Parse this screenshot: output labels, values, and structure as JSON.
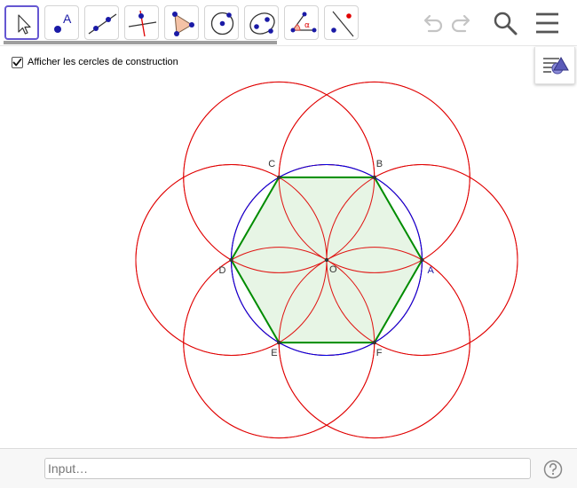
{
  "toolbar": {
    "tools": [
      {
        "name": "move-tool",
        "icon": "cursor-arrow-icon",
        "selected": true
      },
      {
        "name": "point-tool",
        "icon": "point-icon",
        "label": "A"
      },
      {
        "name": "line-tool",
        "icon": "line-through-points-icon"
      },
      {
        "name": "perpendicular-tool",
        "icon": "perpendicular-line-icon"
      },
      {
        "name": "polygon-tool",
        "icon": "polygon-icon"
      },
      {
        "name": "circle-tool",
        "icon": "circle-center-point-icon"
      },
      {
        "name": "conic-tool",
        "icon": "ellipse-icon"
      },
      {
        "name": "angle-tool",
        "icon": "angle-icon",
        "label": "α"
      },
      {
        "name": "reflect-tool",
        "icon": "reflect-about-line-icon"
      }
    ],
    "undo_icon": "undo-icon",
    "redo_icon": "redo-icon",
    "search_icon": "search-icon",
    "menu_icon": "hamburger-menu-icon"
  },
  "checkbox": {
    "label": "Afficher les cercles de construction",
    "checked": true
  },
  "style_bar_icon": "graphics-style-icon",
  "points": {
    "A": {
      "label": "A",
      "color": "#1a1aa6"
    },
    "B": {
      "label": "B",
      "color": "#333333"
    },
    "C": {
      "label": "C",
      "color": "#333333"
    },
    "D": {
      "label": "D",
      "color": "#333333"
    },
    "E": {
      "label": "E",
      "color": "#333333"
    },
    "F": {
      "label": "F",
      "color": "#333333"
    },
    "O": {
      "label": "O",
      "color": "#333333"
    }
  },
  "colors": {
    "construction_circles": "#e00000",
    "circumcircle": "#0000e6",
    "hexagon_stroke": "#008c00",
    "hexagon_fill": "#e3f3e0",
    "accent": "#6557d2"
  },
  "input": {
    "placeholder": "Input…",
    "value": ""
  },
  "help_icon": "help-icon"
}
